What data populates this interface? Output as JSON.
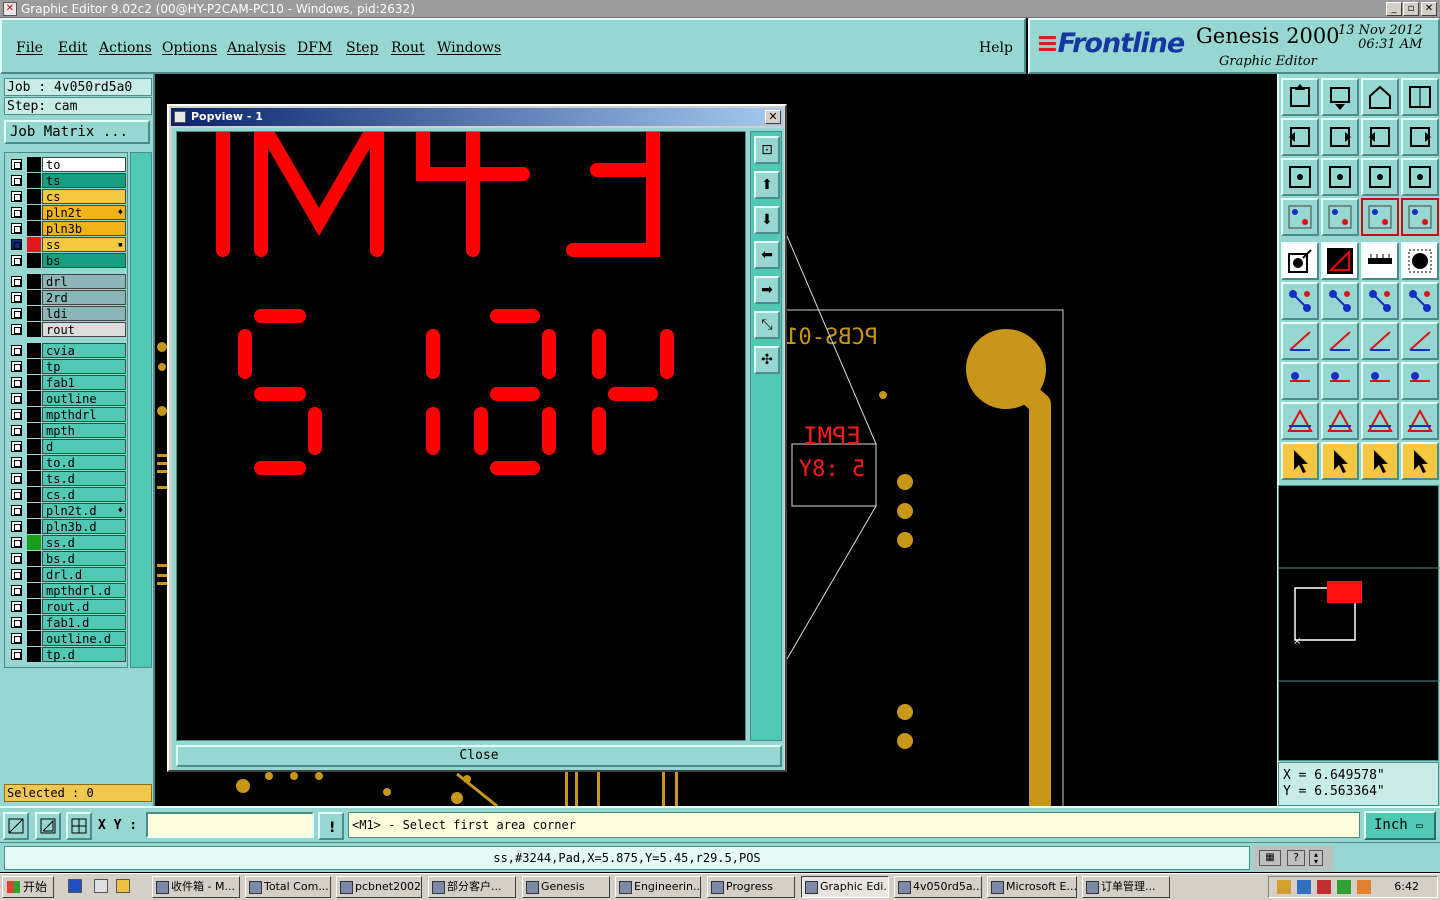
{
  "window": {
    "title": "Graphic Editor 9.02c2 (00@HY-P2CAM-PC10 - Windows, pid:2632)"
  },
  "menu": {
    "items": [
      "File",
      "Edit",
      "Actions",
      "Options",
      "Analysis",
      "DFM",
      "Step",
      "Rout",
      "Windows"
    ],
    "help": "Help"
  },
  "brand": {
    "logo": "Frontline",
    "product": "Genesis 2000",
    "subtitle": "Graphic Editor",
    "date": "13 Nov 2012",
    "time": "06:31 AM"
  },
  "job": {
    "job": "Job : 4v050rd5a0",
    "step": "Step: cam",
    "matrix_button": "Job Matrix ..."
  },
  "layers": [
    {
      "name": "to",
      "color": "#ffffff",
      "swatch": "#000000"
    },
    {
      "name": "ts",
      "color": "#1a9e82",
      "swatch": "#000000"
    },
    {
      "name": "cs",
      "color": "#f5c842",
      "swatch": "#000000"
    },
    {
      "name": "pln2t",
      "color": "#f0b418",
      "swatch": "#000000",
      "mark": "♦"
    },
    {
      "name": "pln3b",
      "color": "#f0b418",
      "swatch": "#000000"
    },
    {
      "name": "ss",
      "color": "#f5c842",
      "swatch": "#e01818",
      "mark": "▪",
      "active": true
    },
    {
      "name": "bs",
      "color": "#1a9e82",
      "swatch": "#000000"
    },
    {
      "name": "drl",
      "color": "#8fb4b8",
      "swatch": "#000000"
    },
    {
      "name": "2rd",
      "color": "#8fb4b8",
      "swatch": "#000000"
    },
    {
      "name": "ldi",
      "color": "#8fb4b8",
      "swatch": "#000000"
    },
    {
      "name": "rout",
      "color": "#dcdcdc",
      "swatch": "#000000"
    },
    {
      "name": "cvia",
      "color": "#4fc8b4",
      "swatch": "#000000"
    },
    {
      "name": "tp",
      "color": "#4fc8b4",
      "swatch": "#000000"
    },
    {
      "name": "fab1",
      "color": "#4fc8b4",
      "swatch": "#000000"
    },
    {
      "name": "outline",
      "color": "#4fc8b4",
      "swatch": "#000000"
    },
    {
      "name": "mpthdrl",
      "color": "#4fc8b4",
      "swatch": "#000000"
    },
    {
      "name": "mpth",
      "color": "#4fc8b4",
      "swatch": "#000000"
    },
    {
      "name": "d",
      "color": "#4fc8b4",
      "swatch": "#000000"
    },
    {
      "name": "to.d",
      "color": "#4fc8b4",
      "swatch": "#000000"
    },
    {
      "name": "ts.d",
      "color": "#4fc8b4",
      "swatch": "#000000"
    },
    {
      "name": "cs.d",
      "color": "#4fc8b4",
      "swatch": "#000000"
    },
    {
      "name": "pln2t.d",
      "color": "#4fc8b4",
      "swatch": "#000000",
      "mark": "♦"
    },
    {
      "name": "pln3b.d",
      "color": "#4fc8b4",
      "swatch": "#000000"
    },
    {
      "name": "ss.d",
      "color": "#4fc8b4",
      "swatch": "#1a9e1a"
    },
    {
      "name": "bs.d",
      "color": "#4fc8b4",
      "swatch": "#000000"
    },
    {
      "name": "drl.d",
      "color": "#4fc8b4",
      "swatch": "#000000"
    },
    {
      "name": "mpthdrl.d",
      "color": "#4fc8b4",
      "swatch": "#000000"
    },
    {
      "name": "rout.d",
      "color": "#4fc8b4",
      "swatch": "#000000"
    },
    {
      "name": "fab1.d",
      "color": "#4fc8b4",
      "swatch": "#000000"
    },
    {
      "name": "outline.d",
      "color": "#4fc8b4",
      "swatch": "#000000"
    },
    {
      "name": "tp.d",
      "color": "#4fc8b4",
      "swatch": "#000000"
    }
  ],
  "selected": "Selected : 0",
  "popview": {
    "title": "Popview - 1",
    "close_label": "Close",
    "text_line1": "EPMI",
    "text_line2": "5 :8Y",
    "mirror": true
  },
  "canvas": {
    "board_text": "PCBS-010",
    "mini_text1": "EPMI",
    "mini_text2": "5 :8Y"
  },
  "coords": {
    "x": "X = 6.649578\"",
    "y": "Y = 6.563364\""
  },
  "bottom": {
    "xy_label": "X Y :",
    "xy_value": "",
    "prompt": "<M1> - Select first area corner",
    "unit": "Inch"
  },
  "status": "ss,#3244,Pad,X=5.875,Y=5.45,r29.5,POS",
  "taskbar": {
    "start": "开始",
    "tasks": [
      "收件箱 - M...",
      "Total Com...",
      "pcbnet2002",
      "部分客户...",
      "Genesis",
      "Engineerin...",
      "Progress",
      "Graphic Edi...",
      "4v050rd5a...",
      "Microsoft E...",
      "订单管理..."
    ],
    "active_index": 7,
    "clock": "6:42"
  },
  "colors": {
    "panel": "#96d7d2",
    "trace": "#c8961a",
    "silk": "#ff0000"
  }
}
